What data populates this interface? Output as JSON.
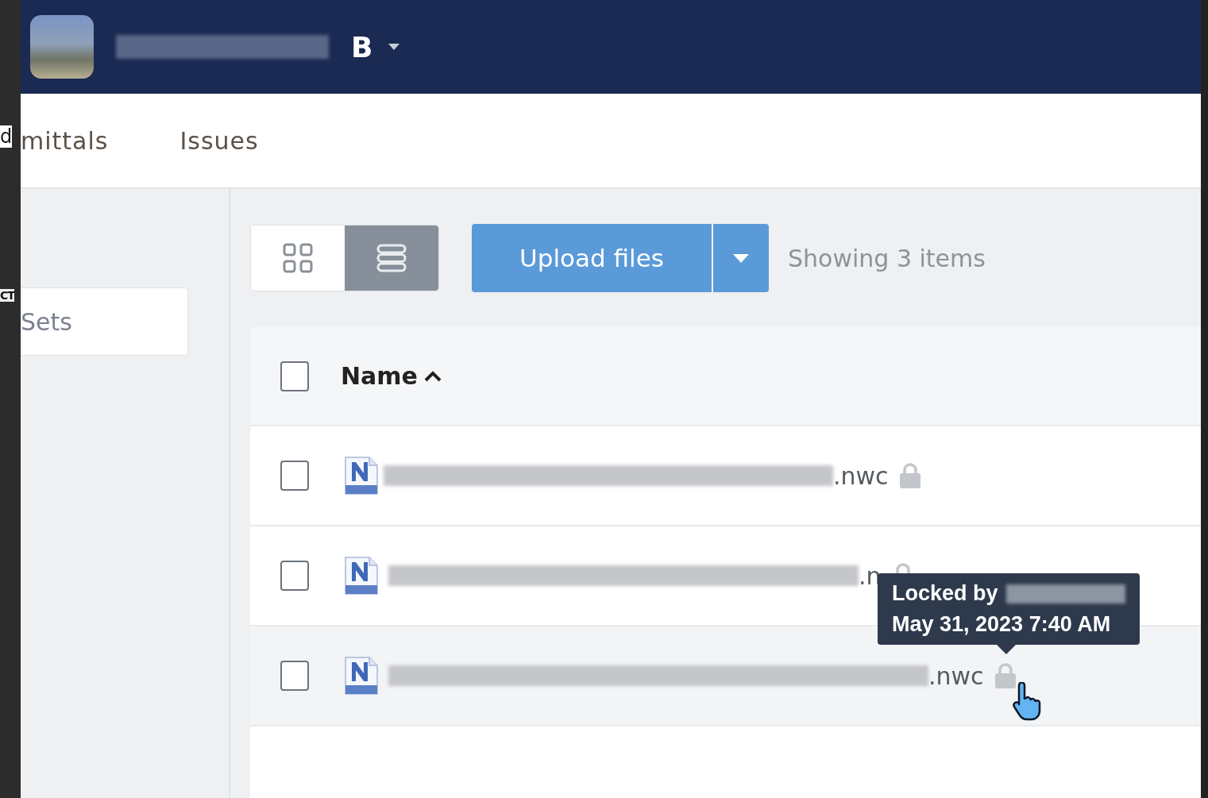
{
  "background_window": {
    "texts": [
      "d",
      "CT"
    ]
  },
  "header": {
    "logo": "B"
  },
  "tabs": [
    {
      "label": "mittals",
      "selected": false
    },
    {
      "label": "Issues",
      "selected": false
    }
  ],
  "sidebar": {
    "field_value": "Sets"
  },
  "toolbar": {
    "views": [
      {
        "kind": "grid",
        "selected": false
      },
      {
        "kind": "list",
        "selected": true
      }
    ],
    "upload_label": "Upload files",
    "count": "Showing 3 items"
  },
  "table": {
    "select_all_checked": false,
    "columns": [
      {
        "label": "Name",
        "sorted_ascending": true
      }
    ],
    "rows": [
      {
        "extension": ".nwc",
        "locked": true,
        "hovered": false,
        "checked": false
      },
      {
        "extension": ".n",
        "locked": true,
        "hovered": false,
        "checked": false
      },
      {
        "extension": ".nwc",
        "locked": true,
        "hovered": true,
        "checked": false
      }
    ]
  },
  "tooltip": {
    "label": "Locked by",
    "date": "May 31, 2023 7:40 AM"
  }
}
